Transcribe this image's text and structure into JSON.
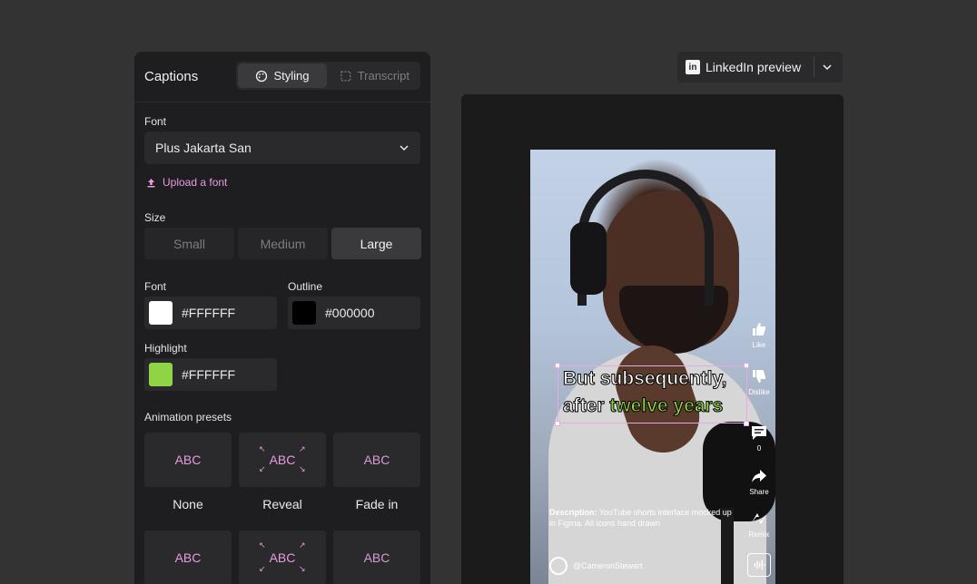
{
  "panel": {
    "title": "Captions",
    "tabs": [
      {
        "label": "Styling",
        "icon": "palette-icon",
        "active": true
      },
      {
        "label": "Transcript",
        "icon": "transcript-icon",
        "active": false
      }
    ],
    "font_label": "Font",
    "font_value": "Plus Jakarta San",
    "upload_label": "Upload a font",
    "size_label": "Size",
    "sizes": [
      "Small",
      "Medium",
      "Large"
    ],
    "selected_size": "Large",
    "font_color_label": "Font",
    "font_color": "#FFFFFF",
    "outline_label": "Outline",
    "outline_color": "#000000",
    "highlight_label": "Highlight",
    "highlight_value": "#FFFFFF",
    "highlight_swatch": "#8fd445",
    "presets_label": "Animation presets",
    "presets": [
      {
        "sample": "ABC",
        "label": "None"
      },
      {
        "sample": "ABC",
        "label": "Reveal"
      },
      {
        "sample": "ABC",
        "label": "Fade in"
      },
      {
        "sample": "ABC",
        "label": ""
      },
      {
        "sample": "ABC",
        "label": ""
      },
      {
        "sample": "ABC",
        "label": ""
      }
    ]
  },
  "preview": {
    "platform_label": "LinkedIn preview",
    "platform_icon": "linkedin-icon",
    "caption_line1": "But subsequently,",
    "caption_line2_prefix": "after ",
    "caption_line2_highlight": "twelve years",
    "actions": [
      {
        "label": "Like",
        "icon": "thumbs-up-icon"
      },
      {
        "label": "Dislike",
        "icon": "thumbs-down-icon"
      },
      {
        "label": "0",
        "icon": "comment-icon"
      },
      {
        "label": "Share",
        "icon": "share-icon"
      },
      {
        "label": "Remix",
        "icon": "remix-icon"
      }
    ],
    "description_bold": "Description:",
    "description_text": " YouTube shorts interface mocked up in Figma. All icons hand drawn",
    "author": "@CameronStewart"
  },
  "colors": {
    "accent": "#e79be2",
    "highlight": "#8fd445"
  }
}
